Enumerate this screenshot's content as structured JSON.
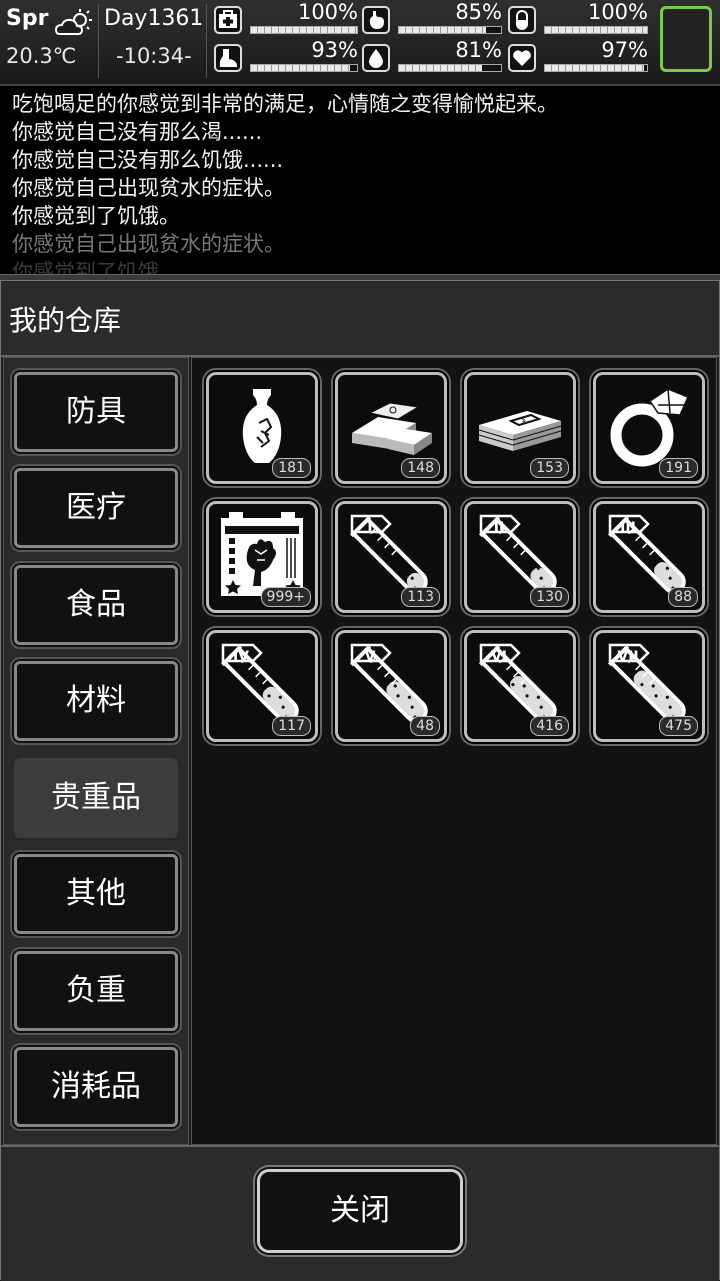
{
  "status": {
    "season": "Spr",
    "temperature": "20.3℃",
    "day": "Day1361",
    "time": "-10:34-",
    "weather_icon": "partly-cloudy-icon",
    "stats": [
      {
        "name": "health",
        "icon": "medkit-icon",
        "value": "100%",
        "level": 1.0
      },
      {
        "name": "fullness",
        "icon": "stomach-icon",
        "value": "85%",
        "level": 0.85
      },
      {
        "name": "immunity",
        "icon": "pill-icon",
        "value": "100%",
        "level": 1.0
      },
      {
        "name": "stamina",
        "icon": "boot-icon",
        "value": "93%",
        "level": 0.93
      },
      {
        "name": "hydration",
        "icon": "water-drop-icon",
        "value": "81%",
        "level": 0.81
      },
      {
        "name": "mood",
        "icon": "heart-icon",
        "value": "97%",
        "level": 0.97
      }
    ],
    "slot_color": "#79c94a"
  },
  "log": [
    "吃饱喝足的你感觉到非常的满足，心情随之变得愉悦起来。",
    "你感觉自己没有那么渴......",
    "你感觉自己没有那么饥饿......",
    "你感觉自己出现贫水的症状。",
    "你感觉到了饥饿。",
    "你感觉自己出现贫水的症状。",
    "你感觉到了饥饿。"
  ],
  "panel": {
    "title": "我的仓库",
    "tabs": [
      "防具",
      "医疗",
      "食品",
      "材料",
      "贵重品",
      "其他",
      "负重",
      "消耗品"
    ],
    "active_tab": "贵重品",
    "items": [
      {
        "icon": "vase-icon",
        "count": "181"
      },
      {
        "icon": "gold-bars-icon",
        "count": "148"
      },
      {
        "icon": "cash-stack-icon",
        "count": "153"
      },
      {
        "icon": "diamond-ring-icon",
        "count": "191"
      },
      {
        "icon": "specimen-card-icon",
        "count": "999+"
      },
      {
        "icon": "test-tube-icon",
        "label": "I",
        "count": "113"
      },
      {
        "icon": "test-tube-icon",
        "label": "II",
        "count": "130"
      },
      {
        "icon": "test-tube-icon",
        "label": "III",
        "count": "88"
      },
      {
        "icon": "test-tube-icon",
        "label": "IV",
        "count": "117"
      },
      {
        "icon": "test-tube-icon",
        "label": "V",
        "count": "48"
      },
      {
        "icon": "test-tube-icon",
        "label": "VI",
        "count": "416"
      },
      {
        "icon": "test-tube-icon",
        "label": "VII",
        "count": "475"
      }
    ],
    "close_label": "关闭"
  }
}
